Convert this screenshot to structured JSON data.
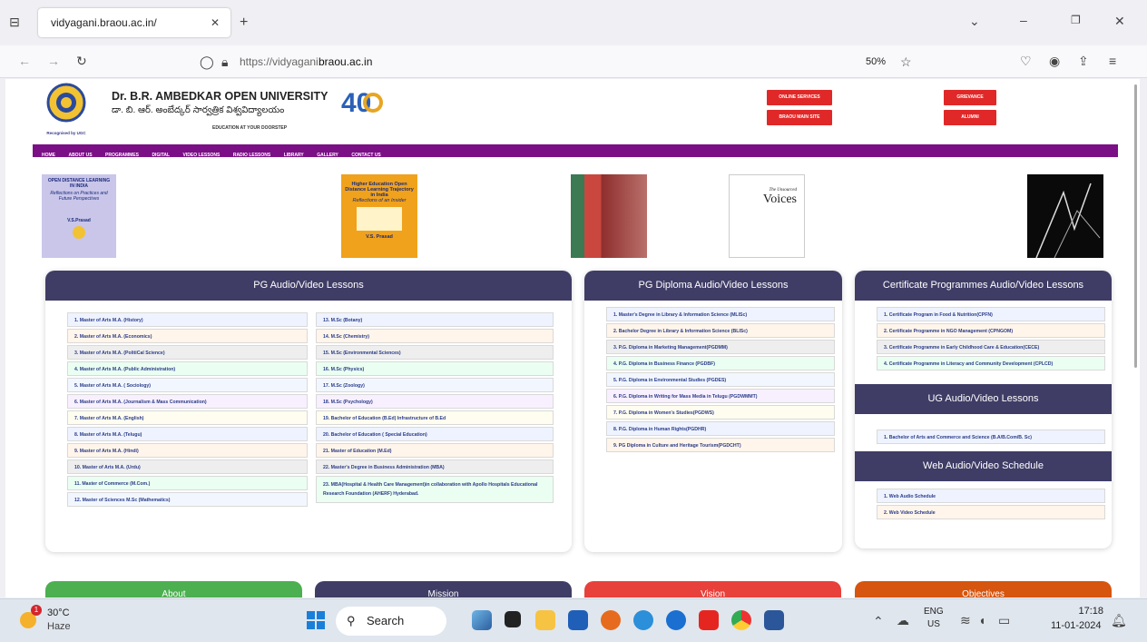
{
  "browser": {
    "tab_title": "vidyagani.braou.ac.in/",
    "url_prefix": "https://vidyagani.",
    "url_host": "braou.ac.in",
    "zoom": "50%"
  },
  "site": {
    "name": "Dr. B.R. AMBEDKAR OPEN UNIVERSITY",
    "name_te": "డా. బి. ఆర్. అంబేద్కర్ సార్వత్రిక విశ్వవిద్యాలయం",
    "tagline": "EDUCATION AT YOUR DOORSTEP",
    "ugc": "Recognised by UGC",
    "anniv": "40",
    "buttons": [
      "ONLINE SERVICES",
      "GRIEVANCE",
      "BRAOU MAIN SITE",
      "ALUMNI"
    ],
    "nav": [
      "HOME",
      "ABOUT US",
      "PROGRAMMES",
      "DIGITAL",
      "VIDEO LESSONS",
      "RADIO LESSONS",
      "LIBRARY",
      "GALLERY",
      "CONTACT US"
    ]
  },
  "books": [
    {
      "title": "OPEN DISTANCE LEARNING IN INDIA",
      "sub": "Reflections on Practices and Future Perspectives",
      "author": "V.S.Prasad"
    },
    {
      "title": "Higher Education Open Distance Learning Trajectory in India",
      "sub": "Reflections of an Insider",
      "author": "V.S. Prasad"
    },
    {
      "title": ""
    },
    {
      "title": "Voices",
      "pre": "The Unsourced"
    },
    {
      "title": ""
    }
  ],
  "pg": {
    "title": "PG Audio/Video Lessons",
    "left": [
      "1. Master of Arts M.A. (History)",
      "2. Master of Arts M.A. (Economics)",
      "3. Master of Arts M.A. (PolitiCal Science)",
      "4. Master of Arts M.A. (Public Administration)",
      "5. Master of Arts M.A. ( Sociology)",
      "6. Master of Arts M.A. (Journalism & Mass Communication)",
      "7. Master of Arts M.A. (English)",
      "8. Master of Arts M.A. (Telugu)",
      "9. Master of Arts M.A. (Hindi)",
      "10. Master of Arts M.A. (Urdu)",
      "11. Master of Commerce (M.Com.)",
      "12. Master of Sciences M.Sc (Mathematics)"
    ],
    "right": [
      "13. M.Sc (Botany)",
      "14. M.Sc (Chemistry)",
      "15. M.Sc (Environmental Sciences)",
      "16. M.Sc (Physics)",
      "17. M.Sc (Zoology)",
      "18. M.Sc (Psychology)",
      "19. Bachelor of Education (B.Ed) Infrastructure of B.Ed",
      "20. Bachelor of Education ( Special Education)",
      "21. Master of Education (M.Ed)",
      "22. Master's Degree in Business Administration (MBA)",
      "23. MBA(Hospital & Health Care Management)in collaboration with Apollo Hospitals Educational Research Foundation (AHERF) Hyderabad."
    ]
  },
  "pgd": {
    "title": "PG Diploma Audio/Video Lessons",
    "items": [
      "1. Master's Degree in Library & Information Science (MLISc)",
      "2. Bachelor Degree in Library & Information Science (BLISc)",
      "3. P.G. Diploma in Marketing Management(PGDMM)",
      "4. P.G. Diploma in Business Finance (PGDBF)",
      "5. P.G. Diploma in Environmental Studies (PGDES)",
      "6. P.G. Diploma in Writing for Mass Media in Telugu (PGDWMMT)",
      "7. P.G. Diploma in Women's Studies(PGDWS)",
      "8. P.G. Diploma in Human Rights(PGDHR)",
      "9. PG Diploma in Culture and Heritage Tourism(PGDCHT)"
    ]
  },
  "cert": {
    "title": "Certificate Programmes Audio/Video Lessons",
    "items": [
      "1. Certificate Program in Food & Nutrition(CPFN)",
      "2. Certificate Programme in NGO Management (CPNGOM)",
      "3. Certificate Programme in Early Childhood Care & Education(CECE)",
      "4. Certificate Programme in Literacy and Community Development (CPLCD)"
    ]
  },
  "ug": {
    "title": "UG Audio/Video Lessons",
    "items": [
      "1. Bachelor of Arts and Commerce and Science (B.A/B.Com/B. Sc)"
    ]
  },
  "web": {
    "title": "Web Audio/Video Schedule",
    "items": [
      "1. Web Audio Schedule",
      "2. Web Video Schedule"
    ]
  },
  "bottom": [
    "About",
    "Mission",
    "Vision",
    "Objectives"
  ],
  "taskbar": {
    "temp": "30°C",
    "weather": "Haze",
    "badge": "1",
    "search": "Search",
    "lang1": "ENG",
    "lang2": "US",
    "time": "17:18",
    "date": "11-01-2024"
  }
}
